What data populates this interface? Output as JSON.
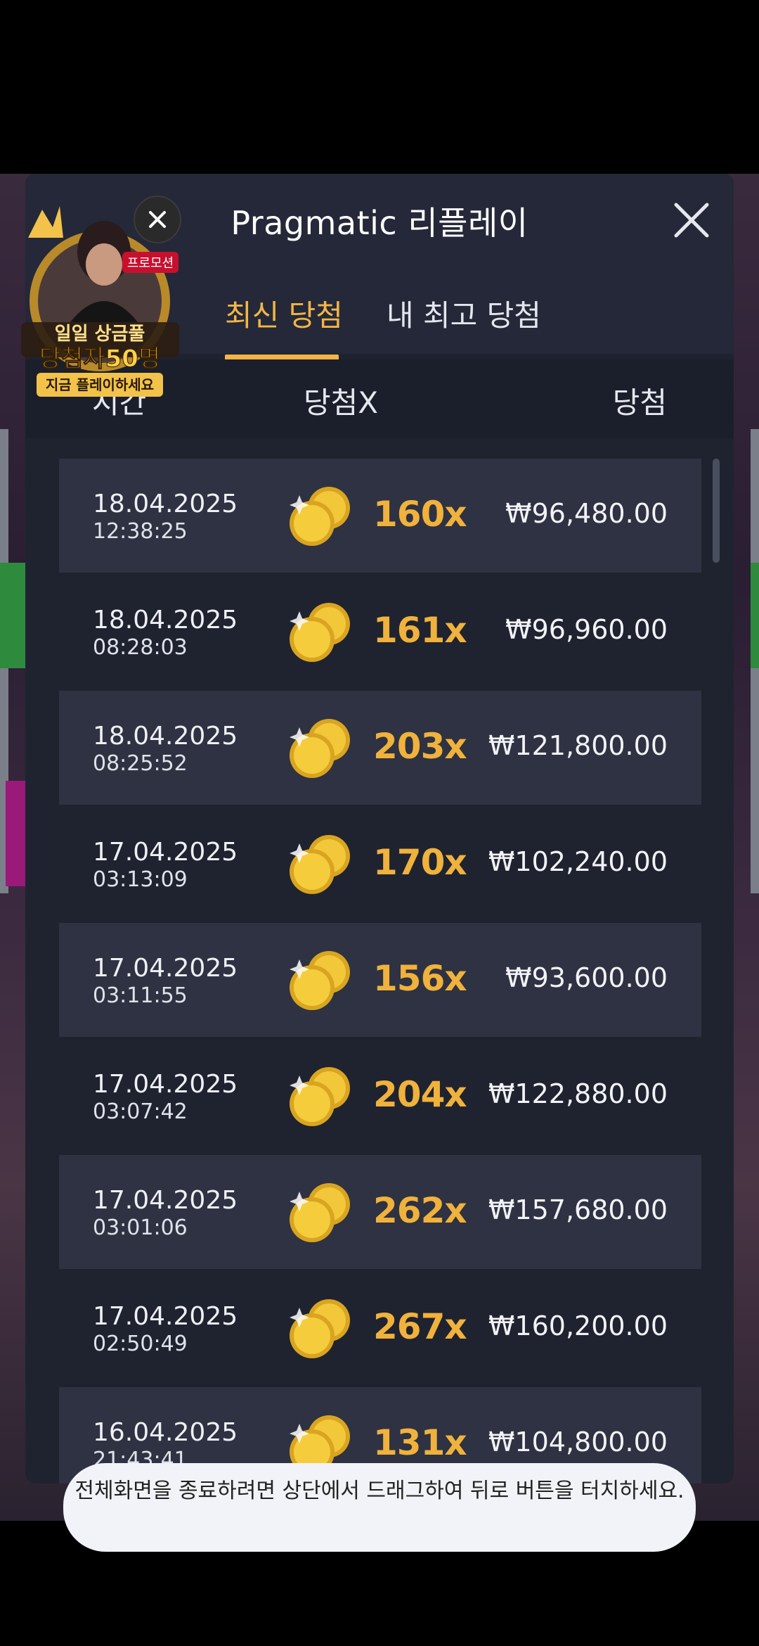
{
  "modal": {
    "title": "Pragmatic 리플레이",
    "tabs": [
      {
        "label": "최신 당첨",
        "active": true
      },
      {
        "label": "내 최고 당첨",
        "active": false
      }
    ],
    "columns": [
      "시간",
      "당첨X",
      "당첨"
    ],
    "rows": [
      {
        "date": "18.04.2025",
        "time": "12:38:25",
        "multiplier": "160x",
        "win": "₩96,480.00"
      },
      {
        "date": "18.04.2025",
        "time": "08:28:03",
        "multiplier": "161x",
        "win": "₩96,960.00"
      },
      {
        "date": "18.04.2025",
        "time": "08:25:52",
        "multiplier": "203x",
        "win": "₩121,800.00"
      },
      {
        "date": "17.04.2025",
        "time": "03:13:09",
        "multiplier": "170x",
        "win": "₩102,240.00"
      },
      {
        "date": "17.04.2025",
        "time": "03:11:55",
        "multiplier": "156x",
        "win": "₩93,600.00"
      },
      {
        "date": "17.04.2025",
        "time": "03:07:42",
        "multiplier": "204x",
        "win": "₩122,880.00"
      },
      {
        "date": "17.04.2025",
        "time": "03:01:06",
        "multiplier": "262x",
        "win": "₩157,680.00"
      },
      {
        "date": "17.04.2025",
        "time": "02:50:49",
        "multiplier": "267x",
        "win": "₩160,200.00"
      },
      {
        "date": "16.04.2025",
        "time": "21:43:41",
        "multiplier": "131x",
        "win": "₩104,800.00"
      }
    ],
    "row_icon": "gold-coins-icon"
  },
  "promo": {
    "badge": "프로모션",
    "line1": "일일 상금풀",
    "line2": "당첨자50명",
    "line3": "지금 플레이하세요"
  },
  "toast": {
    "message": "전체화면을 종료하려면 상단에서 드래그하여 뒤로 버튼을 터치하세요."
  },
  "colors": {
    "accent": "#f2b547",
    "modal_bg": "#1f2330",
    "row_alt": "#2e3242"
  }
}
